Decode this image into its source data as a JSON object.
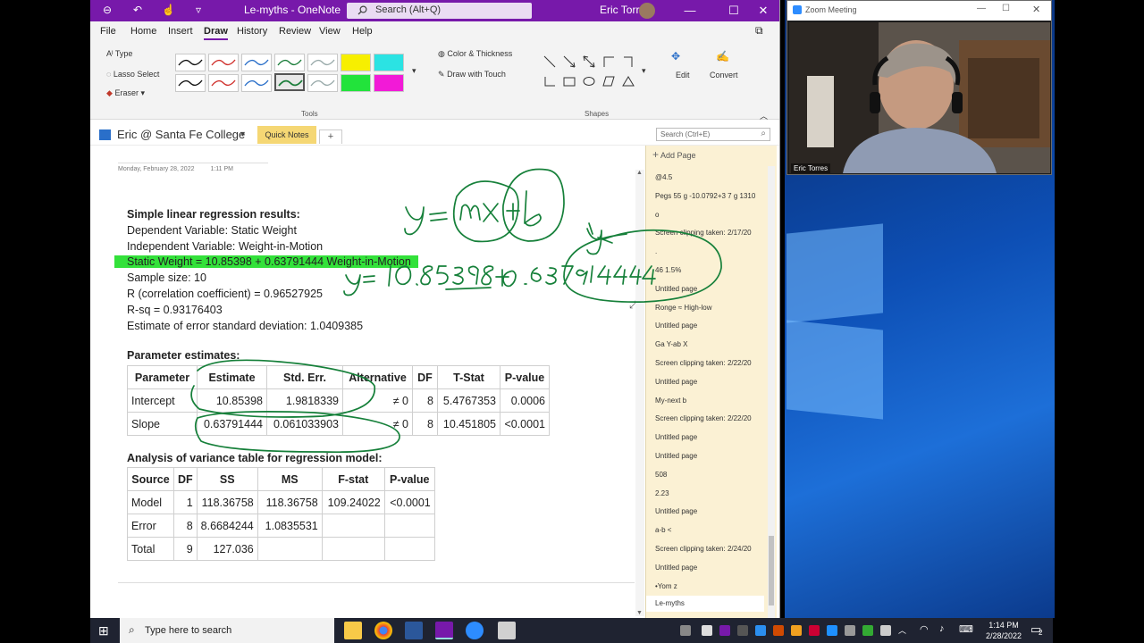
{
  "window": {
    "title": "Le-myths  -  OneNote",
    "search_placeholder": "Search (Alt+Q)",
    "user": "Eric Torres"
  },
  "menu": [
    "File",
    "Home",
    "Insert",
    "Draw",
    "History",
    "Review",
    "View",
    "Help"
  ],
  "ribbon": {
    "type_label": "Type",
    "lasso_label": "Lasso Select",
    "eraser_label": "Eraser",
    "tools_group": "Tools",
    "color_thickness": "Color & Thickness",
    "draw_touch": "Draw with Touch",
    "shapes_group": "Shapes",
    "edit_label": "Edit",
    "convert_label": "Convert"
  },
  "notebook": {
    "name": "Eric @ Santa Fe College",
    "section_tab": "Quick Notes",
    "add_tab": "+",
    "search_placeholder": "Search (Ctrl+E)"
  },
  "page": {
    "date": "Monday, February 28, 2022",
    "time": "1:11 PM",
    "results": {
      "title": "Simple linear regression results:",
      "dependent": "Dependent Variable: Static Weight",
      "independent": "Independent Variable: Weight-in-Motion",
      "equation": "Static Weight = 10.85398 + 0.63791444 Weight-in-Motion",
      "sample_size": "Sample size: 10",
      "r": "R (correlation coefficient) = 0.96527925",
      "rsq": "R-sq = 0.93176403",
      "est_sd": "Estimate of error standard deviation: 1.0409385"
    },
    "params_title": "Parameter estimates:",
    "params_headers": [
      "Parameter",
      "Estimate",
      "Std. Err.",
      "Alternative",
      "DF",
      "T-Stat",
      "P-value"
    ],
    "params_rows": [
      [
        "Intercept",
        "10.85398",
        "1.9818339",
        "≠ 0",
        "8",
        "5.4767353",
        "0.0006"
      ],
      [
        "Slope",
        "0.63791444",
        "0.061033903",
        "≠ 0",
        "8",
        "10.451805",
        "<0.0001"
      ]
    ],
    "anova_title": "Analysis of variance table for regression model:",
    "anova_headers": [
      "Source",
      "DF",
      "SS",
      "MS",
      "F-stat",
      "P-value"
    ],
    "anova_rows": [
      [
        "Model",
        "1",
        "118.36758",
        "118.36758",
        "109.24022",
        "<0.0001"
      ],
      [
        "Error",
        "8",
        "8.6684244",
        "1.0835531",
        "",
        ""
      ],
      [
        "Total",
        "9",
        "127.036",
        "",
        "",
        ""
      ]
    ]
  },
  "pages": {
    "add_label": "Add Page",
    "items": [
      "@4.5",
      "Pegs 55 g -10.0792+3 7 g 1310",
      "o",
      "Screen clipping taken: 2/17/20",
      ".",
      "46 1.5%",
      "Untitled page",
      "Ronge ≈ High-low",
      "Untitled page",
      "Ga Y-ab X",
      "Screen clipping taken: 2/22/20",
      "Untitled page",
      "My-next b",
      "Screen clipping taken: 2/22/20",
      "Untitled page",
      "Untitled page",
      "508",
      "2.23",
      "Untitled page",
      "a-b <",
      "Screen clipping taken: 2/24/20",
      "Untitled page",
      "•Yom z",
      "Le-myths"
    ]
  },
  "zoom": {
    "title": "Zoom Meeting",
    "participant": "Eric Torres"
  },
  "taskbar": {
    "search_placeholder": "Type here to search",
    "time": "1:14 PM",
    "date": "2/28/2022",
    "notif_count": "2"
  },
  "colors": {
    "onenote_purple": "#7719aa",
    "highlight_green": "#33e13a",
    "ink_green": "#16803a",
    "pagelist_bg": "#fbf1d4",
    "quicknotes_tab": "#f5d774"
  }
}
